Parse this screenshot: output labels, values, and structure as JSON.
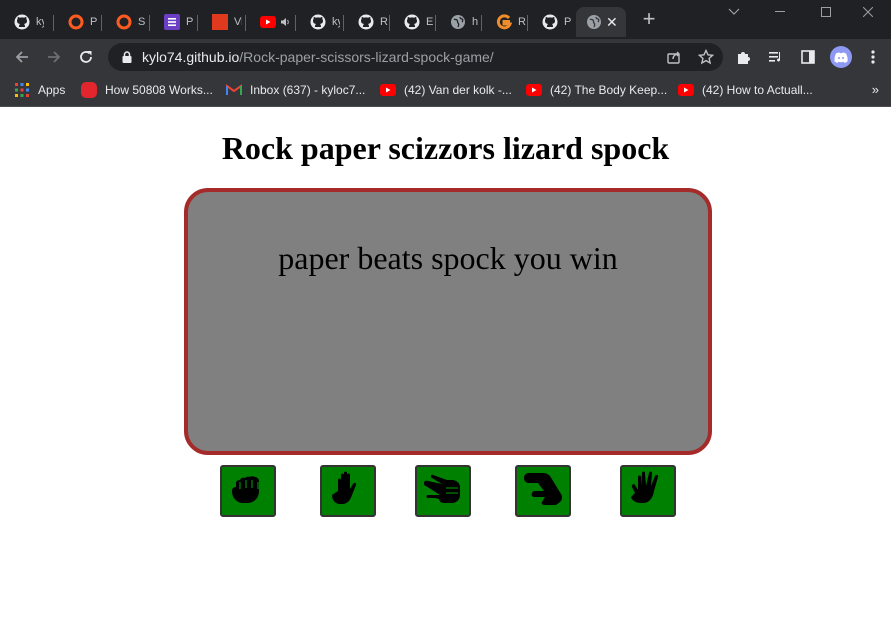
{
  "browser": {
    "tabs": [
      {
        "label": "ky",
        "icon": "github-icon"
      },
      {
        "label": "Pr",
        "icon": "opera-icon"
      },
      {
        "label": "Si",
        "icon": "opera-icon"
      },
      {
        "label": "Pr",
        "icon": "list-icon"
      },
      {
        "label": "Vi",
        "icon": "red-square-icon"
      },
      {
        "label": "",
        "icon": "youtube-icon"
      },
      {
        "label": "ky",
        "icon": "github-icon"
      },
      {
        "label": "R",
        "icon": "github-icon"
      },
      {
        "label": "E",
        "icon": "github-icon"
      },
      {
        "label": "h",
        "icon": "globe-icon"
      },
      {
        "label": "R",
        "icon": "g-icon"
      },
      {
        "label": "P",
        "icon": "github-icon"
      },
      {
        "label": "",
        "icon": "globe-icon"
      }
    ],
    "url_host": "kylo74.github.io",
    "url_path": "/Rock-paper-scissors-lizard-spock-game/",
    "bookmarks": [
      {
        "label": "Apps",
        "icon": "apps-grid-icon"
      },
      {
        "label": "How 50808 Works...",
        "icon": "red-circle-icon"
      },
      {
        "label": "Inbox (637) - kyloc7...",
        "icon": "gmail-icon"
      },
      {
        "label": "(42) Van der kolk -...",
        "icon": "youtube-icon"
      },
      {
        "label": "(42) The Body Keep...",
        "icon": "youtube-icon"
      },
      {
        "label": "(42) How to Actuall...",
        "icon": "youtube-icon"
      }
    ],
    "more": "»"
  },
  "page": {
    "title": "Rock paper scizzors lizard spock",
    "result": "paper beats spock you win",
    "choices": [
      {
        "name": "rock",
        "icon": "hand-rock-icon"
      },
      {
        "name": "paper",
        "icon": "hand-paper-icon"
      },
      {
        "name": "scissors",
        "icon": "hand-scissors-icon"
      },
      {
        "name": "lizard",
        "icon": "hand-lizard-icon"
      },
      {
        "name": "spock",
        "icon": "hand-spock-icon"
      }
    ]
  },
  "colors": {
    "board_bg": "#808080",
    "board_border": "#a52a2a",
    "button_bg": "#008000",
    "chrome_dark": "#202124",
    "chrome_toolbar": "#35363a"
  }
}
